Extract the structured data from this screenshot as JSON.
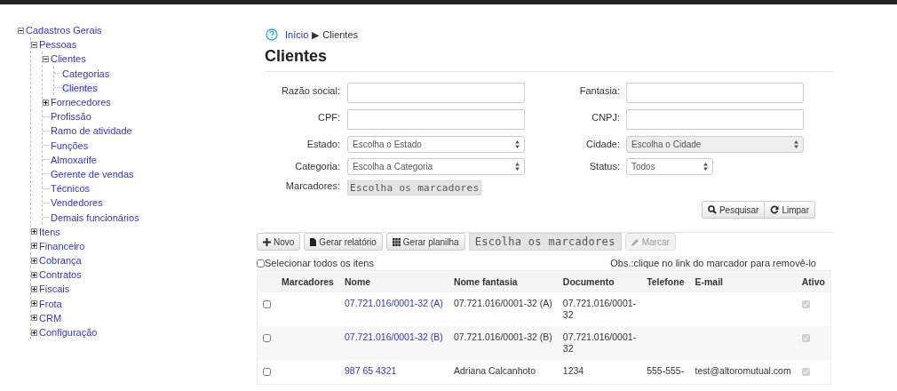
{
  "tree": [
    {
      "label": "Cadastros Gerais",
      "kind": "folder",
      "expanded": true,
      "selected": false,
      "children": [
        {
          "label": "Pessoas",
          "kind": "folder",
          "expanded": true,
          "selected": false,
          "children": [
            {
              "label": "Clientes",
              "kind": "folder",
              "expanded": true,
              "selected": false,
              "children": [
                {
                  "label": "Categorias",
                  "kind": "leaf",
                  "selected": false
                },
                {
                  "label": "Clientes",
                  "kind": "leaf",
                  "selected": true
                }
              ]
            },
            {
              "label": "Fornecedores",
              "kind": "folder",
              "expanded": false,
              "selected": false
            },
            {
              "label": "Profissão",
              "kind": "leaf",
              "selected": false
            },
            {
              "label": "Ramo de atividade",
              "kind": "leaf",
              "selected": false
            },
            {
              "label": "Funções",
              "kind": "leaf",
              "selected": false
            },
            {
              "label": "Almoxarife",
              "kind": "leaf",
              "selected": false
            },
            {
              "label": "Gerente de vendas",
              "kind": "leaf",
              "selected": false
            },
            {
              "label": "Técnicos",
              "kind": "leaf",
              "selected": false
            },
            {
              "label": "Vendedores",
              "kind": "leaf",
              "selected": false
            },
            {
              "label": "Demais funcionários",
              "kind": "leaf",
              "selected": false
            }
          ]
        },
        {
          "label": "Itens",
          "kind": "folder",
          "expanded": false,
          "selected": false
        },
        {
          "label": "Financeiro",
          "kind": "folder",
          "expanded": false,
          "selected": false
        },
        {
          "label": "Cobrança",
          "kind": "folder",
          "expanded": false,
          "selected": false
        },
        {
          "label": "Contratos",
          "kind": "folder",
          "expanded": false,
          "selected": false
        },
        {
          "label": "Fiscais",
          "kind": "folder",
          "expanded": false,
          "selected": false
        },
        {
          "label": "Frota",
          "kind": "folder",
          "expanded": false,
          "selected": false
        },
        {
          "label": "CRM",
          "kind": "folder",
          "expanded": false,
          "selected": false
        },
        {
          "label": "Configuração",
          "kind": "folder",
          "expanded": false,
          "selected": false
        }
      ]
    }
  ],
  "breadcrumb": {
    "link": "Início",
    "separator": "▶",
    "current": "Clientes"
  },
  "title": "Clientes",
  "form": {
    "left": [
      {
        "label": "Razão social:",
        "kind": "text"
      },
      {
        "label": "CPF:",
        "kind": "text"
      },
      {
        "label": "Estado:",
        "kind": "select",
        "value": "Escolha o Estado"
      },
      {
        "label": "Categoria:",
        "kind": "select",
        "value": "Escolha a Categoria"
      },
      {
        "label": "Marcadores:",
        "kind": "tags",
        "value": "Escolha os marcadores"
      }
    ],
    "right": [
      {
        "label": "Fantasia:",
        "kind": "text"
      },
      {
        "label": "CNPJ:",
        "kind": "text"
      },
      {
        "label": "Cidade:",
        "kind": "select",
        "value": "Escolha o Cidade",
        "disabled": true
      },
      {
        "label": "Status:",
        "kind": "select",
        "value": "Todos",
        "disabled": false
      }
    ],
    "buttons": [
      {
        "label": "Pesquisar",
        "kind": "search"
      },
      {
        "label": "Limpar",
        "kind": "refresh"
      }
    ]
  },
  "toolbar": [
    {
      "label": "Novo",
      "kind": "plus"
    },
    {
      "label": "Gerar relatório",
      "kind": "file"
    },
    {
      "label": "Gerar planilha",
      "kind": "grid"
    },
    {
      "label": "Escolha os marcadores",
      "kind": "tags"
    },
    {
      "label": "Marcar",
      "kind": "pencil",
      "disabled": true
    }
  ],
  "select_all": {
    "label": "Selecionar todos os itens",
    "checked": false
  },
  "note": "Obs.:clique no link do marcador para removê-lo",
  "table": {
    "columns": [
      "Marcadores",
      "Nome",
      "Nome fantasia",
      "Documento",
      "Telefone",
      "E-mail",
      "Ativo"
    ],
    "rows": [
      {
        "selected": false,
        "nome": "07.721.016/0001-32 (A)",
        "fantasia": "07.721.016/0001-32 (A)",
        "documento": "07.721.016/0001-32",
        "ativo": true
      },
      {
        "selected": false,
        "nome": "07.721.016/0001-32 (B)",
        "fantasia": "07.721.016/0001-32 (B)",
        "documento": "07.721.016/0001-32",
        "ativo": true
      },
      {
        "selected": false,
        "nome": "987 65 4321",
        "fantasia": "Adriana Calcanhoto",
        "documento": "1234",
        "telefone": "555-555-",
        "email": "test@altoromutual.com",
        "ativo": true
      }
    ]
  }
}
